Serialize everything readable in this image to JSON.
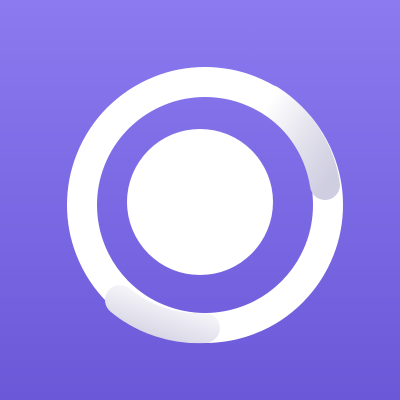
{
  "app_icon": {
    "icon": "ring-with-dot-logo-icon",
    "colors": {
      "background_top": "#8C7AF0",
      "background_bottom": "#6A58D8",
      "mark": "#FFFFFF",
      "shadow": "#CFCDE0"
    }
  }
}
